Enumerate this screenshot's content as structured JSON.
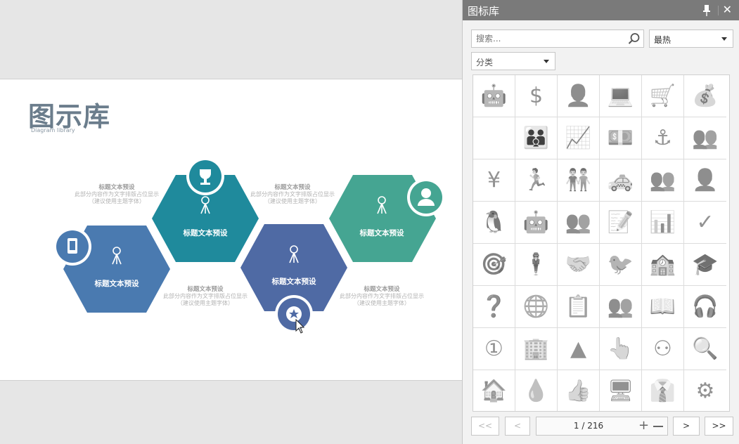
{
  "slide": {
    "title": "图示库",
    "subtitle": "Diagram library",
    "hexagons": [
      {
        "label": "标题文本预设",
        "color": "#4a7ab0"
      },
      {
        "label": "标题文本预设",
        "color": "#1f8a9c"
      },
      {
        "label": "标题文本预设",
        "color": "#4f6aa4"
      },
      {
        "label": "标题文本预设",
        "color": "#45a592"
      }
    ],
    "notes": [
      {
        "title": "标题文本预设",
        "line1": "此部分内容作为文字排版占位显示",
        "line2": "（建议使用主题字体）"
      },
      {
        "title": "标题文本预设",
        "line1": "此部分内容作为文字排版占位显示",
        "line2": "（建议使用主题字体）"
      },
      {
        "title": "标题文本预设",
        "line1": "此部分内容作为文字排版占位显示",
        "line2": "（建议使用主题字体）"
      },
      {
        "title": "标题文本预设",
        "line1": "此部分内容作为文字排版占位显示",
        "line2": "（建议使用主题字体）"
      }
    ]
  },
  "panel": {
    "title": "图标库",
    "search_placeholder": "搜索...",
    "sort_value": "最热",
    "category_value": "分类",
    "icons": [
      {
        "name": "android-icon",
        "glyph": "🤖"
      },
      {
        "name": "dollar-coin-icon",
        "glyph": "$"
      },
      {
        "name": "businessman-icon",
        "glyph": "👤"
      },
      {
        "name": "laptop-chart-icon",
        "glyph": "💻"
      },
      {
        "name": "shopping-cart-icon",
        "glyph": "🛒"
      },
      {
        "name": "money-bag-icon",
        "glyph": "💰"
      },
      {
        "name": "apple-icon",
        "glyph": ""
      },
      {
        "name": "family-icon",
        "glyph": "👪"
      },
      {
        "name": "growth-chart-icon",
        "glyph": "📈"
      },
      {
        "name": "cash-stack-icon",
        "glyph": "💵"
      },
      {
        "name": "anchor-icon",
        "glyph": "⚓"
      },
      {
        "name": "crowd-icon",
        "glyph": "👥"
      },
      {
        "name": "yen-icon",
        "glyph": "¥"
      },
      {
        "name": "runner-icon",
        "glyph": "🏃"
      },
      {
        "name": "business-team-icon",
        "glyph": "👬"
      },
      {
        "name": "taxi-icon",
        "glyph": "🚕"
      },
      {
        "name": "group-icon",
        "glyph": "👥"
      },
      {
        "name": "user-icon",
        "glyph": "👤"
      },
      {
        "name": "qq-penguin-icon",
        "glyph": "🐧"
      },
      {
        "name": "robot-outline-icon",
        "glyph": "🤖"
      },
      {
        "name": "team-icon",
        "glyph": "👥"
      },
      {
        "name": "edit-note-icon",
        "glyph": "📝"
      },
      {
        "name": "presenter-icon",
        "glyph": "📊"
      },
      {
        "name": "checkmark-icon",
        "glyph": "✓"
      },
      {
        "name": "target-icon",
        "glyph": "🎯"
      },
      {
        "name": "person-icon",
        "glyph": "🕴"
      },
      {
        "name": "handshake-icon",
        "glyph": "🤝"
      },
      {
        "name": "twitter-icon",
        "glyph": "🐦"
      },
      {
        "name": "classroom-icon",
        "glyph": "🏫"
      },
      {
        "name": "graduate-icon",
        "glyph": "🎓"
      },
      {
        "name": "question-head-icon",
        "glyph": "❓"
      },
      {
        "name": "globe-cursor-icon",
        "glyph": "🌐"
      },
      {
        "name": "teacher-board-icon",
        "glyph": "📋"
      },
      {
        "name": "people-outline-icon",
        "glyph": "👥"
      },
      {
        "name": "book-search-icon",
        "glyph": "📖"
      },
      {
        "name": "support-agent-icon",
        "glyph": "🎧"
      },
      {
        "name": "coin-one-icon",
        "glyph": "①"
      },
      {
        "name": "building-icon",
        "glyph": "🏢"
      },
      {
        "name": "pyramid-icon",
        "glyph": "▲"
      },
      {
        "name": "hand-pointer-icon",
        "glyph": "👆"
      },
      {
        "name": "network-people-icon",
        "glyph": "⚇"
      },
      {
        "name": "chart-search-icon",
        "glyph": "🔍"
      },
      {
        "name": "house-icon",
        "glyph": "🏠"
      },
      {
        "name": "water-drop-icon",
        "glyph": "💧"
      },
      {
        "name": "thumbs-up-icon",
        "glyph": "👍"
      },
      {
        "name": "monitor-icon",
        "glyph": "🖥"
      },
      {
        "name": "manager-clock-icon",
        "glyph": "👔"
      },
      {
        "name": "gear-head-icon",
        "glyph": "⚙"
      },
      {
        "name": "blank-icon",
        "glyph": ""
      },
      {
        "name": "blank-icon",
        "glyph": ""
      },
      {
        "name": "blank-icon",
        "glyph": ""
      },
      {
        "name": "blank-icon",
        "glyph": ""
      },
      {
        "name": "blank-icon",
        "glyph": ""
      },
      {
        "name": "blank-icon",
        "glyph": ""
      }
    ],
    "pagination": {
      "first": "<<",
      "prev": "<",
      "info": "1 / 216",
      "next": ">",
      "last": ">>"
    }
  }
}
